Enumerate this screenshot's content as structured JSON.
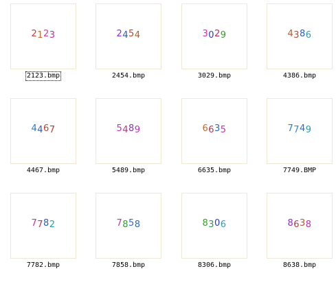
{
  "thumbnails": [
    {
      "file": "2123.bmp",
      "digits": [
        [
          "2",
          "#cc3a3a"
        ],
        [
          "1",
          "#c26a2a"
        ],
        [
          "2",
          "#d03c9c"
        ],
        [
          "3",
          "#c4309a"
        ]
      ],
      "focused": true
    },
    {
      "file": "2454.bmp",
      "digits": [
        [
          "2",
          "#8a30c8"
        ],
        [
          "4",
          "#2a5ac0"
        ],
        [
          "5",
          "#b6462e"
        ],
        [
          "4",
          "#b65a2a"
        ]
      ],
      "focused": false
    },
    {
      "file": "3029.bmp",
      "digits": [
        [
          "3",
          "#d12ac4"
        ],
        [
          "0",
          "#2a3ac0"
        ],
        [
          "2",
          "#c02a5a"
        ],
        [
          "9",
          "#3a9a2a"
        ]
      ],
      "focused": false
    },
    {
      "file": "4386.bmp",
      "digits": [
        [
          "4",
          "#b65a2a"
        ],
        [
          "3",
          "#c24a2a"
        ],
        [
          "8",
          "#2a5ad0"
        ],
        [
          "6",
          "#2a9ab4"
        ]
      ],
      "focused": false
    },
    {
      "file": "4467.bmp",
      "digits": [
        [
          "4",
          "#2a7ad0"
        ],
        [
          "4",
          "#2a5ac0"
        ],
        [
          "6",
          "#b6462e"
        ],
        [
          "7",
          "#b63a2a"
        ]
      ],
      "focused": false
    },
    {
      "file": "5489.bmp",
      "digits": [
        [
          "5",
          "#d12ac4"
        ],
        [
          "4",
          "#c2307a"
        ],
        [
          "8",
          "#8a30c8"
        ],
        [
          "9",
          "#c030b4"
        ]
      ],
      "focused": false
    },
    {
      "file": "6635.bmp",
      "digits": [
        [
          "6",
          "#c26a2a"
        ],
        [
          "6",
          "#c2304a"
        ],
        [
          "3",
          "#2a6ad0"
        ],
        [
          "5",
          "#c030b4"
        ]
      ],
      "focused": false
    },
    {
      "file": "7749.BMP",
      "digits": [
        [
          "7",
          "#2a7ad0"
        ],
        [
          "7",
          "#2a8ad0"
        ],
        [
          "4",
          "#2a6ad0"
        ],
        [
          "9",
          "#2a9ab4"
        ]
      ],
      "focused": false
    },
    {
      "file": "7782.bmp",
      "digits": [
        [
          "7",
          "#c030b4"
        ],
        [
          "7",
          "#c2304a"
        ],
        [
          "8",
          "#2a5ac0"
        ],
        [
          "2",
          "#2a9ab4"
        ]
      ],
      "focused": false
    },
    {
      "file": "7858.bmp",
      "digits": [
        [
          "7",
          "#c030b4"
        ],
        [
          "8",
          "#3a9a3a"
        ],
        [
          "5",
          "#2a6ad0"
        ],
        [
          "8",
          "#2a6ad0"
        ]
      ],
      "focused": false
    },
    {
      "file": "8306.bmp",
      "digits": [
        [
          "8",
          "#3a9a2a"
        ],
        [
          "3",
          "#2a9a4a"
        ],
        [
          "0",
          "#2a3ac0"
        ],
        [
          "6",
          "#2a9ab4"
        ]
      ],
      "focused": false
    },
    {
      "file": "8638.bmp",
      "digits": [
        [
          "8",
          "#8a30c8"
        ],
        [
          "6",
          "#c2304a"
        ],
        [
          "3",
          "#b65a2a"
        ],
        [
          "8",
          "#c030b4"
        ]
      ],
      "focused": false
    }
  ]
}
